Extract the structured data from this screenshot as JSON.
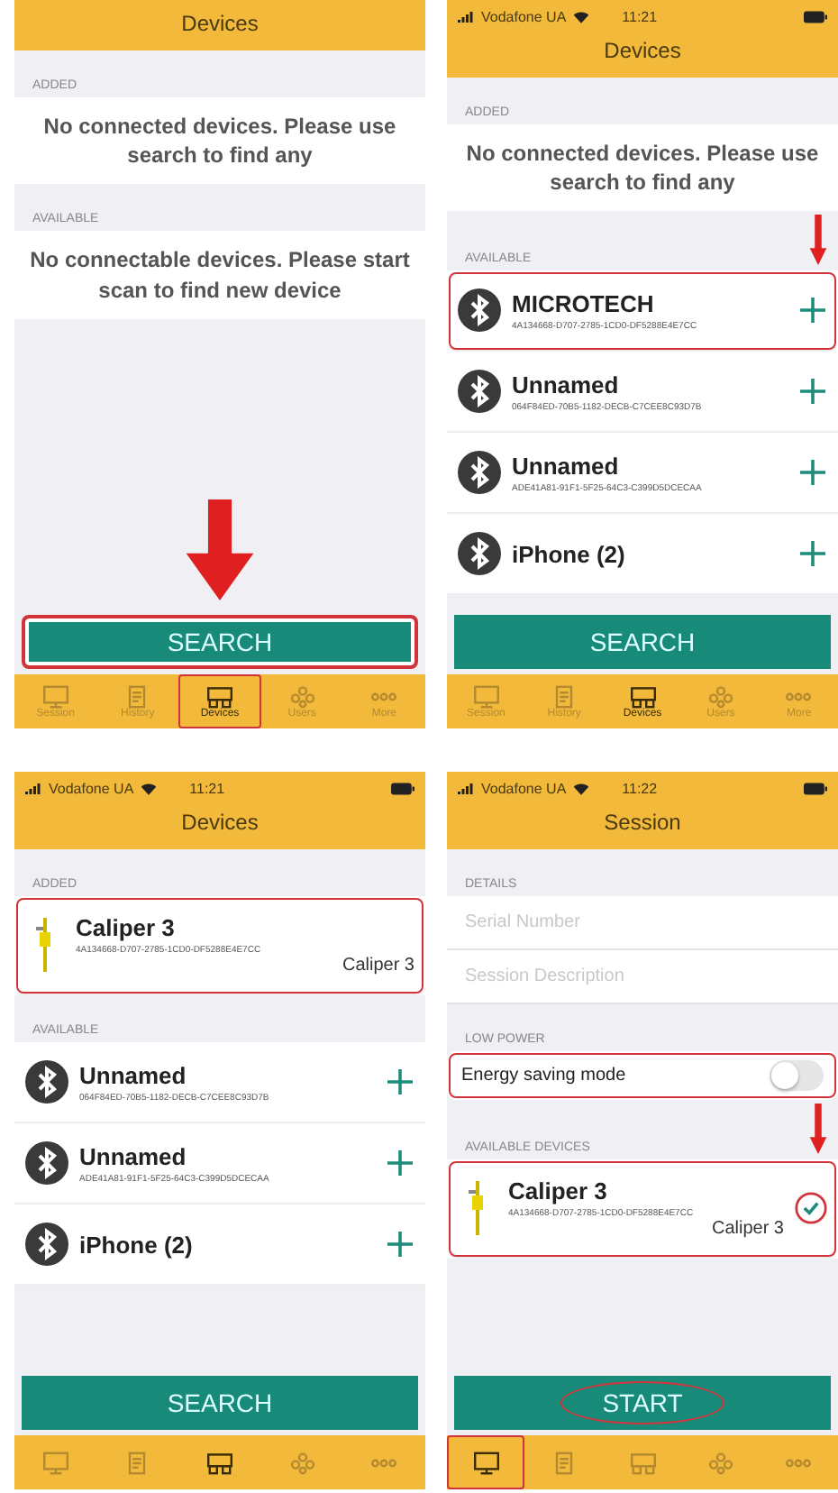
{
  "panels": [
    {
      "title": "Devices",
      "sections": [
        {
          "kind": "message",
          "header": "ADDED",
          "text": "No connected devices. Please use search to find any"
        },
        {
          "kind": "message",
          "header": "AVAILABLE",
          "text": "No connectable devices. Please start scan to find new device"
        }
      ],
      "button": {
        "label": "SEARCH",
        "highlighted": true,
        "circled": false,
        "arrow": true
      },
      "tabs": [
        {
          "label": "Session",
          "selected": false,
          "highlighted": false
        },
        {
          "label": "History",
          "selected": false,
          "highlighted": false
        },
        {
          "label": "Devices",
          "selected": true,
          "highlighted": true
        },
        {
          "label": "Users",
          "selected": false,
          "highlighted": false
        },
        {
          "label": "More",
          "selected": false,
          "highlighted": false
        }
      ]
    },
    {
      "status": {
        "carrier": "Vodafone UA",
        "time": "11:21"
      },
      "title": "Devices",
      "sections": [
        {
          "kind": "message",
          "header": "ADDED",
          "text": "No connected devices. Please use search to find any"
        },
        {
          "kind": "devices",
          "header": "AVAILABLE",
          "devices": [
            {
              "kind": "bluetooth",
              "name": "MICROTECH",
              "id": "4A134668-D707-2785-1CD0-DF5288E4E7CC",
              "checked": false,
              "highlighted": true,
              "arrow": true
            },
            {
              "kind": "bluetooth",
              "name": "Unnamed",
              "id": "064F84ED-70B5-1182-DECB-C7CEE8C93D7B",
              "checked": false,
              "highlighted": false,
              "arrow": false
            },
            {
              "kind": "bluetooth",
              "name": "Unnamed",
              "id": "ADE41A81-91F1-5F25-64C3-C399D5DCECAA",
              "checked": false,
              "highlighted": false,
              "arrow": false
            },
            {
              "kind": "bluetooth",
              "name": "iPhone (2)",
              "checked": false,
              "highlighted": false,
              "arrow": false
            }
          ]
        }
      ],
      "button": {
        "label": "SEARCH",
        "highlighted": false,
        "circled": false,
        "arrow": false
      },
      "tabs": [
        {
          "label": "Session",
          "selected": false,
          "highlighted": false
        },
        {
          "label": "History",
          "selected": false,
          "highlighted": false
        },
        {
          "label": "Devices",
          "selected": true,
          "highlighted": false
        },
        {
          "label": "Users",
          "selected": false,
          "highlighted": false
        },
        {
          "label": "More",
          "selected": false,
          "highlighted": false
        }
      ]
    },
    {
      "status": {
        "carrier": "Vodafone UA",
        "time": "11:21"
      },
      "title": "Devices",
      "sections": [
        {
          "kind": "devices",
          "header": "ADDED",
          "devices": [
            {
              "kind": "caliper",
              "name": "Caliper 3",
              "id": "4A134668-D707-2785-1CD0-DF5288E4E7CC",
              "alias": "Caliper 3",
              "checked": false,
              "highlighted": true,
              "arrow": false
            }
          ]
        },
        {
          "kind": "devices",
          "header": "AVAILABLE",
          "devices": [
            {
              "kind": "bluetooth",
              "name": "Unnamed",
              "id": "064F84ED-70B5-1182-DECB-C7CEE8C93D7B",
              "checked": false,
              "highlighted": false,
              "arrow": false
            },
            {
              "kind": "bluetooth",
              "name": "Unnamed",
              "id": "ADE41A81-91F1-5F25-64C3-C399D5DCECAA",
              "checked": false,
              "highlighted": false,
              "arrow": false
            },
            {
              "kind": "bluetooth",
              "name": "iPhone (2)",
              "checked": false,
              "highlighted": false,
              "arrow": false
            }
          ]
        }
      ],
      "button": {
        "label": "SEARCH",
        "highlighted": false,
        "circled": false,
        "arrow": false
      },
      "tabs": [
        {
          "selected": false,
          "highlighted": false
        },
        {
          "selected": false,
          "highlighted": false
        },
        {
          "selected": true,
          "highlighted": false
        },
        {
          "selected": false,
          "highlighted": false
        },
        {
          "selected": false,
          "highlighted": false
        }
      ]
    },
    {
      "status": {
        "carrier": "Vodafone UA",
        "time": "11:22"
      },
      "title": "Session",
      "sections": [
        {
          "kind": "fields",
          "header": "DETAILS",
          "fields": [
            {
              "placeholder": "Serial Number"
            },
            {
              "placeholder": "Session Description"
            }
          ]
        },
        {
          "kind": "toggle",
          "header": "LOW POWER",
          "label": "Energy saving mode",
          "on": false,
          "highlighted": true
        },
        {
          "kind": "devices",
          "header": "AVAILABLE DEVICES",
          "devices": [
            {
              "kind": "caliper",
              "name": "Caliper 3",
              "id": "4A134668-D707-2785-1CD0-DF5288E4E7CC",
              "alias": "Caliper 3",
              "checked": true,
              "highlighted": true,
              "arrow": true
            }
          ]
        }
      ],
      "button": {
        "label": "START",
        "highlighted": false,
        "circled": true,
        "arrow": false
      },
      "tabs": [
        {
          "selected": true,
          "highlighted": true
        },
        {
          "selected": false,
          "highlighted": false
        },
        {
          "selected": false,
          "highlighted": false
        },
        {
          "selected": false,
          "highlighted": false
        },
        {
          "selected": false,
          "highlighted": false
        }
      ]
    }
  ]
}
